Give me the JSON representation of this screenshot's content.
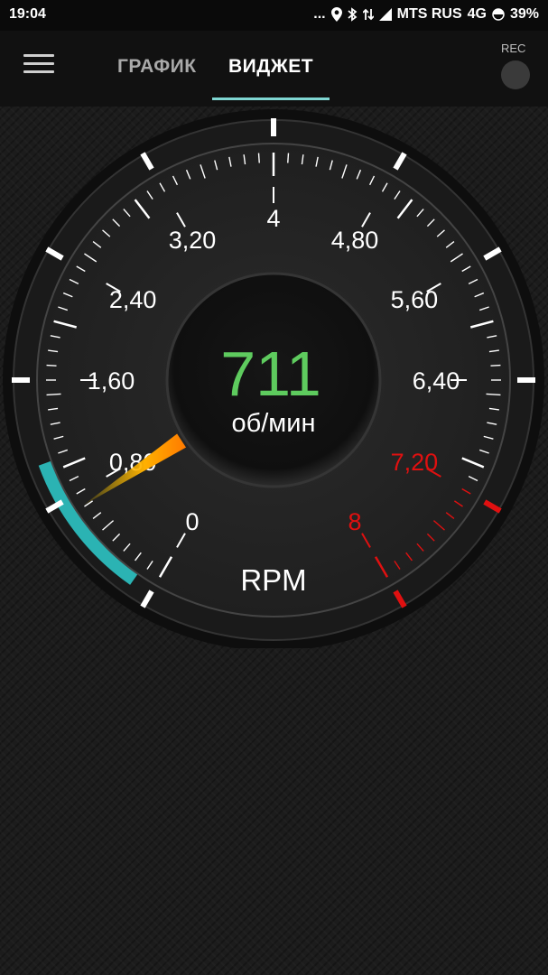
{
  "status": {
    "time": "19:04",
    "dots": "...",
    "carrier": "MTS RUS",
    "network": "4G",
    "battery": "39%"
  },
  "appbar": {
    "tabs": [
      {
        "label": "ГРАФИК",
        "active": false
      },
      {
        "label": "ВИДЖЕТ",
        "active": true
      }
    ],
    "rec_label": "REC"
  },
  "gauge": {
    "value": "711",
    "unit": "об/мин",
    "title": "RPM",
    "needle_value": 0.711,
    "scale_min": 0,
    "scale_max": 8,
    "redline_from": 7.2,
    "labels": [
      "0",
      "0,80",
      "1,60",
      "2,40",
      "3,20",
      "4",
      "4,80",
      "5,60",
      "6,40",
      "7,20",
      "8"
    ],
    "colors": {
      "value": "#5ecb5e",
      "redline": "#e01010",
      "accent": "#2bb3b3",
      "needle": "#ffa500"
    }
  }
}
